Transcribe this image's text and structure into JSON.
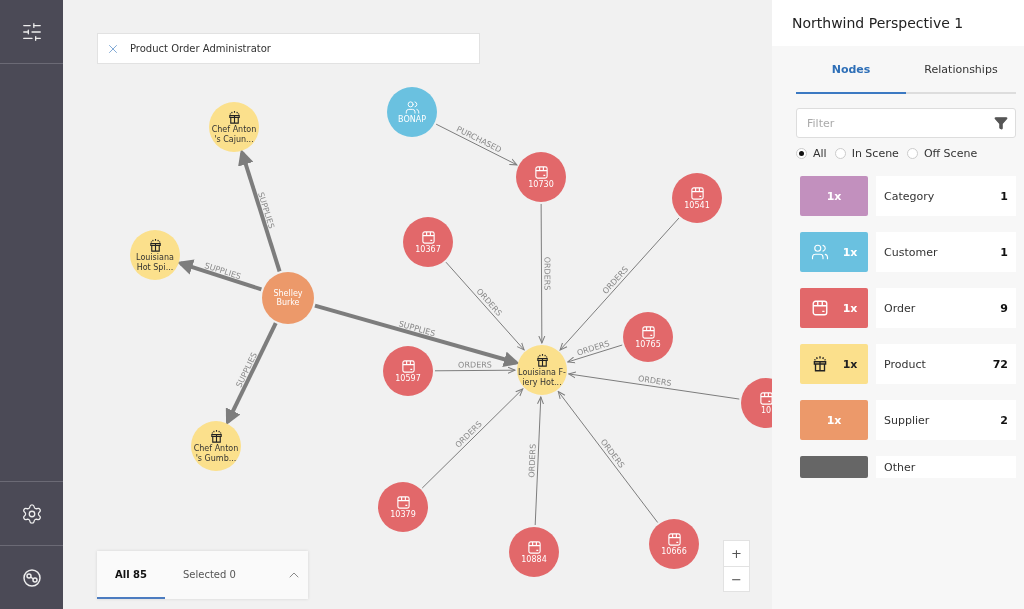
{
  "search": {
    "value": "Product Order Administrator"
  },
  "graph": {
    "nodes": [
      {
        "kind": "customer",
        "label_lines": [
          "BONAP"
        ]
      },
      {
        "kind": "product",
        "label_lines": [
          "Chef Anton",
          "'s Cajun..."
        ]
      },
      {
        "kind": "order",
        "label_lines": [
          "10730"
        ]
      },
      {
        "kind": "order",
        "label_lines": [
          "10541"
        ]
      },
      {
        "kind": "order",
        "label_lines": [
          "10367"
        ]
      },
      {
        "kind": "product",
        "label_lines": [
          "Louisiana",
          "Hot Spi..."
        ]
      },
      {
        "kind": "supplier",
        "label_lines": [
          "Shelley",
          "Burke"
        ]
      },
      {
        "kind": "order",
        "label_lines": [
          "10765"
        ]
      },
      {
        "kind": "order",
        "label_lines": [
          "10597"
        ]
      },
      {
        "kind": "product",
        "label_lines": [
          "Louisiana F-",
          "iery Hot..."
        ]
      },
      {
        "kind": "order",
        "label_lines": [
          "10"
        ]
      },
      {
        "kind": "product",
        "label_lines": [
          "Chef Anton",
          "'s Gumb..."
        ]
      },
      {
        "kind": "order",
        "label_lines": [
          "10379"
        ]
      },
      {
        "kind": "order",
        "label_lines": [
          "10884"
        ]
      },
      {
        "kind": "order",
        "label_lines": [
          "10666"
        ]
      }
    ],
    "edges": [
      {
        "label": "SUPPLIES"
      },
      {
        "label": "SUPPLIES"
      },
      {
        "label": "SUPPLIES"
      },
      {
        "label": "SUPPLIES"
      },
      {
        "label": "PURCHASED"
      },
      {
        "label": "ORDERS"
      },
      {
        "label": "ORDERS"
      },
      {
        "label": "ORDERS"
      },
      {
        "label": "ORDERS"
      },
      {
        "label": "ORDERS"
      },
      {
        "label": "ORDERS"
      },
      {
        "label": "ORDERS"
      },
      {
        "label": "ORDERS"
      },
      {
        "label": "ORDERS"
      }
    ]
  },
  "result_tabs": [
    {
      "label": "All 85",
      "selected": true
    },
    {
      "label": "Selected 0",
      "selected": false
    }
  ],
  "zoom": {
    "in": "+",
    "out": "−"
  },
  "panel": {
    "title": "Northwind Perspective 1",
    "tabs": [
      {
        "label": "Nodes",
        "selected": true
      },
      {
        "label": "Relationships",
        "selected": false
      }
    ],
    "filter": {
      "placeholder": "Filter"
    },
    "scope": [
      {
        "label": "All",
        "selected": true
      },
      {
        "label": "In Scene",
        "selected": false
      },
      {
        "label": "Off Scene",
        "selected": false
      }
    ],
    "categories": [
      {
        "kind": "plain",
        "name": "Category",
        "badge": "1x",
        "count": "1",
        "color": "#c290be"
      },
      {
        "kind": "customer",
        "name": "Customer",
        "badge": "1x",
        "count": "1",
        "color": "#6ac1e0"
      },
      {
        "kind": "order",
        "name": "Order",
        "badge": "1x",
        "count": "9",
        "color": "#e2686a"
      },
      {
        "kind": "product",
        "name": "Product",
        "badge": "1x",
        "count": "72",
        "color": "#fbe08c"
      },
      {
        "kind": "plain",
        "name": "Supplier",
        "badge": "1x",
        "count": "2",
        "color": "#ec996a"
      },
      {
        "kind": "plain",
        "name": "Other",
        "color": "#666666"
      }
    ]
  }
}
